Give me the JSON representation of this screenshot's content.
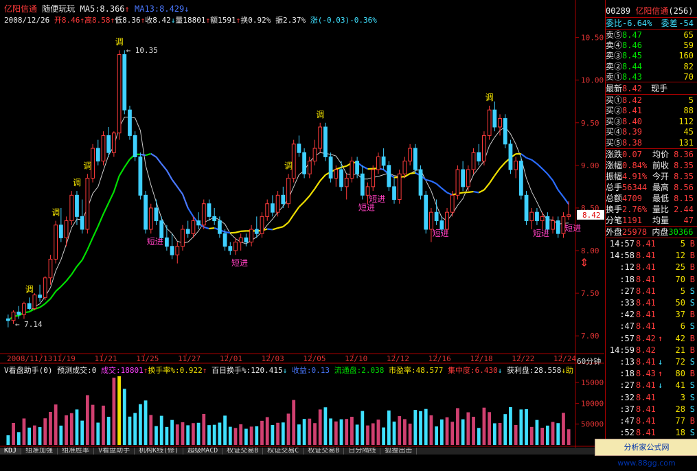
{
  "header": {
    "stock_name": "亿阳信通",
    "formula_name": "随便玩玩",
    "ma5_label": "MA5:8.366",
    "ma5_arrow": "↑",
    "ma13_label": "MA13:8.429",
    "ma13_arrow": "↓",
    "date": "2008/12/26",
    "open": "开8.46",
    "open_arrow": "↑",
    "high": "高8.58",
    "high_arrow": "↑",
    "low": "低8.36",
    "low_arrow": "↑",
    "close": "收8.42",
    "close_arrow": "↓",
    "volume": "量18801",
    "volume_arrow": "↑",
    "amount": "额1591",
    "amount_arrow": "↑",
    "turnover": "换0.92%",
    "amplitude": "振2.37%",
    "change": "涨(-0.03)-0.36%"
  },
  "chart_data": {
    "type": "candlestick",
    "title": "",
    "period_label": "60分钟",
    "ylim": [
      6.8,
      10.65
    ],
    "y_ticks": [
      "10.50",
      "10.00",
      "9.50",
      "9.00",
      "8.50",
      "8.00",
      "7.50",
      "7.00"
    ],
    "y_tick_values": [
      10.5,
      10.0,
      9.5,
      9.0,
      8.5,
      8.0,
      7.5,
      7.0
    ],
    "x_labels": [
      "2008/11/13",
      "11/19",
      "11/21",
      "11/25",
      "11/27",
      "12/01",
      "12/03",
      "12/05",
      "12/10",
      "12/12",
      "12/16",
      "12/18",
      "12/22",
      "12/24"
    ],
    "current_price_label": "8.42",
    "max_label": "10.35",
    "min_label": "7.14",
    "ohlc": [
      [
        7.2,
        7.25,
        7.1,
        7.18
      ],
      [
        7.18,
        7.3,
        7.14,
        7.28
      ],
      [
        7.28,
        7.35,
        7.2,
        7.25
      ],
      [
        7.25,
        7.4,
        7.2,
        7.38
      ],
      [
        7.38,
        7.45,
        7.3,
        7.32
      ],
      [
        7.32,
        7.5,
        7.3,
        7.48
      ],
      [
        7.48,
        7.6,
        7.4,
        7.45
      ],
      [
        7.45,
        7.7,
        7.42,
        7.68
      ],
      [
        7.68,
        7.95,
        7.6,
        7.9
      ],
      [
        7.9,
        8.35,
        7.85,
        8.3
      ],
      [
        8.3,
        8.5,
        8.1,
        8.15
      ],
      [
        8.15,
        8.4,
        8.05,
        8.35
      ],
      [
        8.35,
        8.7,
        8.3,
        8.65
      ],
      [
        8.65,
        8.7,
        8.3,
        8.4
      ],
      [
        8.4,
        8.6,
        8.2,
        8.25
      ],
      [
        8.25,
        8.9,
        8.2,
        8.85
      ],
      [
        8.85,
        9.25,
        8.8,
        9.2
      ],
      [
        9.2,
        9.3,
        9.0,
        9.05
      ],
      [
        9.05,
        9.4,
        9.0,
        9.35
      ],
      [
        9.35,
        9.45,
        9.1,
        9.15
      ],
      [
        9.15,
        9.4,
        9.1,
        9.38
      ],
      [
        9.38,
        10.35,
        9.3,
        10.3
      ],
      [
        10.3,
        10.35,
        9.6,
        9.65
      ],
      [
        9.65,
        9.7,
        9.3,
        9.35
      ],
      [
        9.35,
        9.4,
        9.05,
        9.1
      ],
      [
        9.1,
        9.15,
        8.6,
        8.65
      ],
      [
        8.65,
        8.7,
        8.2,
        8.25
      ],
      [
        8.25,
        8.55,
        8.2,
        8.5
      ],
      [
        8.5,
        8.6,
        8.3,
        8.35
      ],
      [
        8.35,
        8.4,
        8.1,
        8.15
      ],
      [
        8.15,
        8.3,
        8.0,
        8.05
      ],
      [
        8.05,
        8.2,
        7.9,
        7.95
      ],
      [
        7.95,
        8.1,
        7.85,
        8.05
      ],
      [
        8.05,
        8.3,
        8.0,
        8.25
      ],
      [
        8.25,
        8.35,
        8.15,
        8.2
      ],
      [
        8.2,
        8.4,
        8.15,
        8.35
      ],
      [
        8.35,
        8.45,
        8.25,
        8.3
      ],
      [
        8.3,
        8.6,
        8.25,
        8.55
      ],
      [
        8.55,
        8.6,
        8.35,
        8.4
      ],
      [
        8.4,
        8.5,
        8.3,
        8.35
      ],
      [
        8.35,
        8.4,
        8.15,
        8.2
      ],
      [
        8.2,
        8.25,
        8.0,
        8.05
      ],
      [
        8.05,
        8.1,
        7.95,
        8.0
      ],
      [
        8.0,
        8.15,
        7.95,
        8.1
      ],
      [
        8.1,
        8.2,
        8.0,
        8.15
      ],
      [
        8.15,
        8.2,
        8.05,
        8.1
      ],
      [
        8.1,
        8.3,
        8.05,
        8.25
      ],
      [
        8.25,
        8.4,
        8.15,
        8.2
      ],
      [
        8.2,
        8.45,
        8.15,
        8.4
      ],
      [
        8.4,
        8.6,
        8.35,
        8.55
      ],
      [
        8.55,
        8.65,
        8.4,
        8.45
      ],
      [
        8.45,
        8.7,
        8.4,
        8.65
      ],
      [
        8.65,
        8.75,
        8.5,
        8.55
      ],
      [
        8.55,
        8.9,
        8.5,
        8.85
      ],
      [
        8.85,
        9.3,
        8.8,
        9.25
      ],
      [
        9.25,
        9.35,
        9.1,
        9.15
      ],
      [
        9.15,
        9.2,
        8.85,
        8.9
      ],
      [
        8.9,
        9.1,
        8.85,
        9.05
      ],
      [
        9.05,
        9.3,
        9.0,
        9.2
      ],
      [
        9.2,
        9.5,
        9.15,
        9.45
      ],
      [
        9.45,
        9.5,
        9.05,
        9.1
      ],
      [
        9.1,
        9.15,
        8.8,
        8.85
      ],
      [
        8.85,
        9.0,
        8.75,
        8.95
      ],
      [
        8.95,
        9.05,
        8.7,
        8.75
      ],
      [
        8.75,
        8.9,
        8.6,
        8.85
      ],
      [
        8.85,
        9.1,
        8.8,
        9.05
      ],
      [
        9.05,
        9.1,
        8.85,
        8.9
      ],
      [
        8.9,
        9.0,
        8.6,
        8.65
      ],
      [
        8.65,
        8.8,
        8.55,
        8.75
      ],
      [
        8.75,
        9.0,
        8.7,
        8.95
      ],
      [
        8.95,
        9.15,
        8.9,
        9.1
      ],
      [
        9.1,
        9.2,
        8.95,
        9.0
      ],
      [
        9.0,
        9.05,
        8.7,
        8.75
      ],
      [
        8.75,
        8.85,
        8.55,
        8.6
      ],
      [
        8.6,
        8.95,
        8.55,
        8.9
      ],
      [
        8.9,
        9.1,
        8.85,
        9.05
      ],
      [
        9.05,
        9.25,
        9.0,
        9.2
      ],
      [
        9.2,
        9.25,
        8.9,
        8.95
      ],
      [
        8.95,
        9.0,
        8.6,
        8.65
      ],
      [
        8.65,
        8.7,
        8.2,
        8.25
      ],
      [
        8.25,
        8.5,
        8.1,
        8.45
      ],
      [
        8.45,
        8.6,
        8.3,
        8.35
      ],
      [
        8.35,
        8.4,
        8.2,
        8.25
      ],
      [
        8.25,
        8.5,
        8.2,
        8.45
      ],
      [
        8.45,
        8.7,
        8.4,
        8.65
      ],
      [
        8.65,
        9.0,
        8.6,
        8.95
      ],
      [
        8.95,
        9.05,
        8.7,
        8.75
      ],
      [
        8.75,
        9.0,
        8.7,
        8.95
      ],
      [
        8.95,
        9.2,
        8.9,
        9.15
      ],
      [
        9.15,
        9.25,
        9.0,
        9.05
      ],
      [
        9.05,
        9.4,
        9.0,
        9.35
      ],
      [
        9.35,
        9.7,
        9.3,
        9.65
      ],
      [
        9.65,
        9.75,
        9.4,
        9.45
      ],
      [
        9.45,
        9.6,
        9.35,
        9.55
      ],
      [
        9.55,
        9.6,
        9.2,
        9.25
      ],
      [
        9.25,
        9.3,
        8.9,
        8.95
      ],
      [
        8.95,
        9.1,
        8.85,
        9.05
      ],
      [
        9.05,
        9.1,
        8.6,
        8.65
      ],
      [
        8.65,
        8.7,
        8.3,
        8.35
      ],
      [
        8.35,
        8.5,
        8.25,
        8.45
      ],
      [
        8.45,
        8.5,
        8.3,
        8.35
      ],
      [
        8.35,
        8.45,
        8.25,
        8.4
      ],
      [
        8.4,
        8.45,
        8.2,
        8.25
      ],
      [
        8.25,
        8.4,
        8.2,
        8.35
      ],
      [
        8.35,
        8.4,
        8.15,
        8.2
      ],
      [
        8.2,
        8.45,
        8.15,
        8.4
      ],
      [
        8.4,
        8.58,
        8.36,
        8.42
      ]
    ],
    "signals": [
      {
        "label": "调",
        "bar": 21,
        "pos": "above",
        "color": "#f0e000"
      },
      {
        "label": "调",
        "bar": 4,
        "pos": "above",
        "color": "#f0e000"
      },
      {
        "label": "调",
        "bar": 9,
        "pos": "above",
        "color": "#f0e000"
      },
      {
        "label": "调",
        "bar": 13,
        "pos": "above",
        "color": "#f0e000"
      },
      {
        "label": "调",
        "bar": 15,
        "pos": "above",
        "color": "#f0e000"
      },
      {
        "label": "调",
        "bar": 53,
        "pos": "above",
        "color": "#f0e000"
      },
      {
        "label": "调",
        "bar": 59,
        "pos": "above",
        "color": "#f0e000"
      },
      {
        "label": "调",
        "bar": 91,
        "pos": "above",
        "color": "#f0e000"
      },
      {
        "label": "短进",
        "bar": 27,
        "pos": "below",
        "color": "#ff40c0"
      },
      {
        "label": "短进",
        "bar": 43,
        "pos": "below",
        "color": "#ff40c0"
      },
      {
        "label": "短进",
        "bar": 67,
        "pos": "below",
        "color": "#ff40c0"
      },
      {
        "label": "短进",
        "bar": 69,
        "pos": "below",
        "color": "#ff40c0"
      },
      {
        "label": "短进",
        "bar": 81,
        "pos": "below",
        "color": "#ff40c0"
      },
      {
        "label": "短进",
        "bar": 100,
        "pos": "below",
        "color": "#ff40c0"
      },
      {
        "label": "短进",
        "bar": 106,
        "pos": "below",
        "color": "#ff40c0"
      }
    ],
    "volume": {
      "ylim": [
        0,
        170000
      ],
      "y_ticks": [
        "150000",
        "100000",
        "50000"
      ],
      "y_tick_values": [
        150000,
        100000,
        50000
      ]
    }
  },
  "volume_bar": {
    "title": "V看盘助手(0)",
    "predict": "预测成交:0",
    "deal": "成交:18801",
    "deal_arrow": "↑",
    "turnover_rate": "换手率%:0.922",
    "turnover_arrow": "↑",
    "hundred_day": "百日换手%:120.415",
    "hundred_arrow": "↓",
    "earnings": "收益:0.13",
    "float_cap": "流通盘:2.038",
    "pe": "市盈率:48.577",
    "concentration": "集中度:6.430",
    "concentration_arrow": "↓",
    "profit_disk": "获利盘:28.558",
    "profit_arrow": "↓",
    "tail": "助"
  },
  "tabs": [
    "KDJ",
    "组准加强",
    "组准胜率",
    "V看盘助手",
    "机构K线(修)",
    "超级MACD",
    "权证交易B",
    "权证交易C",
    "权证交易B",
    "日分隔线",
    "狐狸出击"
  ],
  "panel": {
    "code": "00289",
    "name": "亿阳信通",
    "count": "(256)",
    "webi_label": "委比",
    "webi_value": "-6.64%",
    "weicha_label": "委差",
    "weicha_value": "-54",
    "asks": [
      {
        "label": "卖⑤",
        "price": "8.47",
        "vol": "65"
      },
      {
        "label": "卖④",
        "price": "8.46",
        "vol": "59"
      },
      {
        "label": "卖③",
        "price": "8.45",
        "vol": "160"
      },
      {
        "label": "卖②",
        "price": "8.44",
        "vol": "82"
      },
      {
        "label": "卖①",
        "price": "8.43",
        "vol": "70"
      }
    ],
    "latest_label": "最新",
    "latest_price": "8.42",
    "latest_hand": "现手",
    "bids": [
      {
        "label": "买①",
        "price": "8.42",
        "vol": "5"
      },
      {
        "label": "买②",
        "price": "8.41",
        "vol": "88"
      },
      {
        "label": "买③",
        "price": "8.40",
        "vol": "112"
      },
      {
        "label": "买④",
        "price": "8.39",
        "vol": "45"
      },
      {
        "label": "买⑤",
        "price": "8.38",
        "vol": "131"
      }
    ],
    "stats": [
      {
        "l1": "涨跌",
        "v1": "0.07",
        "l2": "均价",
        "v2": "8.36"
      },
      {
        "l1": "涨幅",
        "v1": "0.84%",
        "l2": "前收",
        "v2": "8.35"
      },
      {
        "l1": "振幅",
        "v1": "4.91%",
        "l2": "今开",
        "v2": "8.35"
      },
      {
        "l1": "总手",
        "v1": "56344",
        "l2": "最高",
        "v2": "8.56"
      },
      {
        "l1": "总额",
        "v1": "4709",
        "l2": "最低",
        "v2": "8.15"
      },
      {
        "l1": "换手",
        "v1": "2.76%",
        "l2": "量比",
        "v2": "2.44"
      },
      {
        "l1": "分笔",
        "v1": "1191",
        "l2": "均量",
        "v2": "47"
      }
    ],
    "outer_label": "外盘",
    "outer_value": "25978",
    "inner_label": "内盘",
    "inner_value": "30366",
    "ticks": [
      {
        "t": "14:57",
        "p": "8.41",
        "a": "",
        "v": "5",
        "s": "B"
      },
      {
        "t": "14:58",
        "p": "8.41",
        "a": "",
        "v": "12",
        "s": "B"
      },
      {
        "t": ":12",
        "p": "8.41",
        "a": "",
        "v": "25",
        "s": "B"
      },
      {
        "t": ":18",
        "p": "8.41",
        "a": "",
        "v": "70",
        "s": "B"
      },
      {
        "t": ":27",
        "p": "8.41",
        "a": "",
        "v": "5",
        "s": "S"
      },
      {
        "t": ":33",
        "p": "8.41",
        "a": "",
        "v": "50",
        "s": "S"
      },
      {
        "t": ":42",
        "p": "8.41",
        "a": "",
        "v": "37",
        "s": "B"
      },
      {
        "t": ":47",
        "p": "8.41",
        "a": "",
        "v": "6",
        "s": "S"
      },
      {
        "t": ":57",
        "p": "8.42",
        "a": "↑",
        "v": "42",
        "s": "B"
      },
      {
        "t": "14:59",
        "p": "8.42",
        "a": "",
        "v": "21",
        "s": "B"
      },
      {
        "t": ":13",
        "p": "8.41",
        "a": "↓",
        "v": "72",
        "s": "S"
      },
      {
        "t": ":18",
        "p": "8.43",
        "a": "↑",
        "v": "80",
        "s": "B"
      },
      {
        "t": ":27",
        "p": "8.41",
        "a": "↓",
        "v": "41",
        "s": "S"
      },
      {
        "t": ":32",
        "p": "8.41",
        "a": "",
        "v": "3",
        "s": "S"
      },
      {
        "t": ":37",
        "p": "8.41",
        "a": "",
        "v": "28",
        "s": "S"
      },
      {
        "t": ":47",
        "p": "8.41",
        "a": "",
        "v": "77",
        "s": "B"
      },
      {
        "t": ":52",
        "p": "8.41",
        "a": "",
        "v": "18",
        "s": "S"
      },
      {
        "t": ":57",
        "p": "8.41",
        "a": "",
        "v": "88",
        "s": "S"
      }
    ]
  },
  "brand_text": "分析家公式网www.88gg.com"
}
